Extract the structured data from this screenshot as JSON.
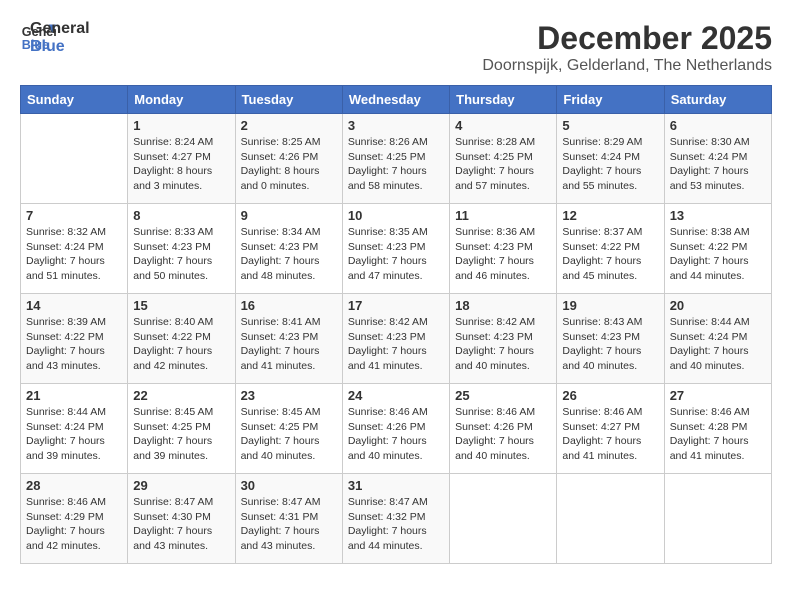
{
  "header": {
    "logo_line1": "General",
    "logo_line2": "Blue",
    "month": "December 2025",
    "location": "Doornspijk, Gelderland, The Netherlands"
  },
  "days_of_week": [
    "Sunday",
    "Monday",
    "Tuesday",
    "Wednesday",
    "Thursday",
    "Friday",
    "Saturday"
  ],
  "weeks": [
    [
      {
        "day": "",
        "info": ""
      },
      {
        "day": "1",
        "info": "Sunrise: 8:24 AM\nSunset: 4:27 PM\nDaylight: 8 hours\nand 3 minutes."
      },
      {
        "day": "2",
        "info": "Sunrise: 8:25 AM\nSunset: 4:26 PM\nDaylight: 8 hours\nand 0 minutes."
      },
      {
        "day": "3",
        "info": "Sunrise: 8:26 AM\nSunset: 4:25 PM\nDaylight: 7 hours\nand 58 minutes."
      },
      {
        "day": "4",
        "info": "Sunrise: 8:28 AM\nSunset: 4:25 PM\nDaylight: 7 hours\nand 57 minutes."
      },
      {
        "day": "5",
        "info": "Sunrise: 8:29 AM\nSunset: 4:24 PM\nDaylight: 7 hours\nand 55 minutes."
      },
      {
        "day": "6",
        "info": "Sunrise: 8:30 AM\nSunset: 4:24 PM\nDaylight: 7 hours\nand 53 minutes."
      }
    ],
    [
      {
        "day": "7",
        "info": "Sunrise: 8:32 AM\nSunset: 4:24 PM\nDaylight: 7 hours\nand 51 minutes."
      },
      {
        "day": "8",
        "info": "Sunrise: 8:33 AM\nSunset: 4:23 PM\nDaylight: 7 hours\nand 50 minutes."
      },
      {
        "day": "9",
        "info": "Sunrise: 8:34 AM\nSunset: 4:23 PM\nDaylight: 7 hours\nand 48 minutes."
      },
      {
        "day": "10",
        "info": "Sunrise: 8:35 AM\nSunset: 4:23 PM\nDaylight: 7 hours\nand 47 minutes."
      },
      {
        "day": "11",
        "info": "Sunrise: 8:36 AM\nSunset: 4:23 PM\nDaylight: 7 hours\nand 46 minutes."
      },
      {
        "day": "12",
        "info": "Sunrise: 8:37 AM\nSunset: 4:22 PM\nDaylight: 7 hours\nand 45 minutes."
      },
      {
        "day": "13",
        "info": "Sunrise: 8:38 AM\nSunset: 4:22 PM\nDaylight: 7 hours\nand 44 minutes."
      }
    ],
    [
      {
        "day": "14",
        "info": "Sunrise: 8:39 AM\nSunset: 4:22 PM\nDaylight: 7 hours\nand 43 minutes."
      },
      {
        "day": "15",
        "info": "Sunrise: 8:40 AM\nSunset: 4:22 PM\nDaylight: 7 hours\nand 42 minutes."
      },
      {
        "day": "16",
        "info": "Sunrise: 8:41 AM\nSunset: 4:23 PM\nDaylight: 7 hours\nand 41 minutes."
      },
      {
        "day": "17",
        "info": "Sunrise: 8:42 AM\nSunset: 4:23 PM\nDaylight: 7 hours\nand 41 minutes."
      },
      {
        "day": "18",
        "info": "Sunrise: 8:42 AM\nSunset: 4:23 PM\nDaylight: 7 hours\nand 40 minutes."
      },
      {
        "day": "19",
        "info": "Sunrise: 8:43 AM\nSunset: 4:23 PM\nDaylight: 7 hours\nand 40 minutes."
      },
      {
        "day": "20",
        "info": "Sunrise: 8:44 AM\nSunset: 4:24 PM\nDaylight: 7 hours\nand 40 minutes."
      }
    ],
    [
      {
        "day": "21",
        "info": "Sunrise: 8:44 AM\nSunset: 4:24 PM\nDaylight: 7 hours\nand 39 minutes."
      },
      {
        "day": "22",
        "info": "Sunrise: 8:45 AM\nSunset: 4:25 PM\nDaylight: 7 hours\nand 39 minutes."
      },
      {
        "day": "23",
        "info": "Sunrise: 8:45 AM\nSunset: 4:25 PM\nDaylight: 7 hours\nand 40 minutes."
      },
      {
        "day": "24",
        "info": "Sunrise: 8:46 AM\nSunset: 4:26 PM\nDaylight: 7 hours\nand 40 minutes."
      },
      {
        "day": "25",
        "info": "Sunrise: 8:46 AM\nSunset: 4:26 PM\nDaylight: 7 hours\nand 40 minutes."
      },
      {
        "day": "26",
        "info": "Sunrise: 8:46 AM\nSunset: 4:27 PM\nDaylight: 7 hours\nand 41 minutes."
      },
      {
        "day": "27",
        "info": "Sunrise: 8:46 AM\nSunset: 4:28 PM\nDaylight: 7 hours\nand 41 minutes."
      }
    ],
    [
      {
        "day": "28",
        "info": "Sunrise: 8:46 AM\nSunset: 4:29 PM\nDaylight: 7 hours\nand 42 minutes."
      },
      {
        "day": "29",
        "info": "Sunrise: 8:47 AM\nSunset: 4:30 PM\nDaylight: 7 hours\nand 43 minutes."
      },
      {
        "day": "30",
        "info": "Sunrise: 8:47 AM\nSunset: 4:31 PM\nDaylight: 7 hours\nand 43 minutes."
      },
      {
        "day": "31",
        "info": "Sunrise: 8:47 AM\nSunset: 4:32 PM\nDaylight: 7 hours\nand 44 minutes."
      },
      {
        "day": "",
        "info": ""
      },
      {
        "day": "",
        "info": ""
      },
      {
        "day": "",
        "info": ""
      }
    ]
  ]
}
